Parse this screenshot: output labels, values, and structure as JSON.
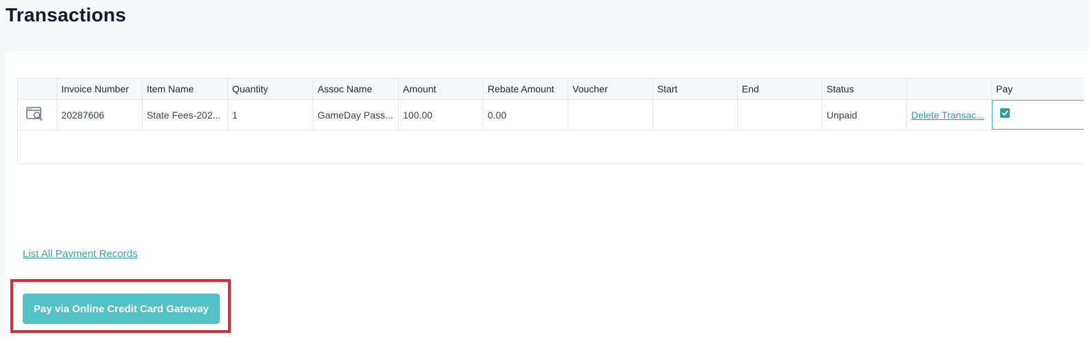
{
  "page": {
    "title": "Transactions"
  },
  "table": {
    "headers": [
      "",
      "Invoice Number",
      "Item Name",
      "Quantity",
      "Assoc Name",
      "Amount",
      "Rebate Amount",
      "Voucher",
      "Start",
      "End",
      "Status",
      "",
      "Pay"
    ],
    "rows": [
      {
        "view_icon": "view-invoice-icon",
        "invoice_number": "20287606",
        "item_name": "State Fees-202...",
        "quantity": "1",
        "assoc_name": "GameDay Pass...",
        "amount": "100.00",
        "rebate_amount": "0.00",
        "voucher": "",
        "start": "",
        "end": "",
        "status": "Unpaid",
        "action": "Delete Transac...",
        "pay_checked": true
      }
    ]
  },
  "links": {
    "list_all": "List All Payment Records"
  },
  "actions": {
    "pay_button": "Pay via Online Credit Card Gateway"
  },
  "colors": {
    "accent": "#52c2c7",
    "link": "#2f9ea3",
    "highlight": "#dd2a35"
  }
}
